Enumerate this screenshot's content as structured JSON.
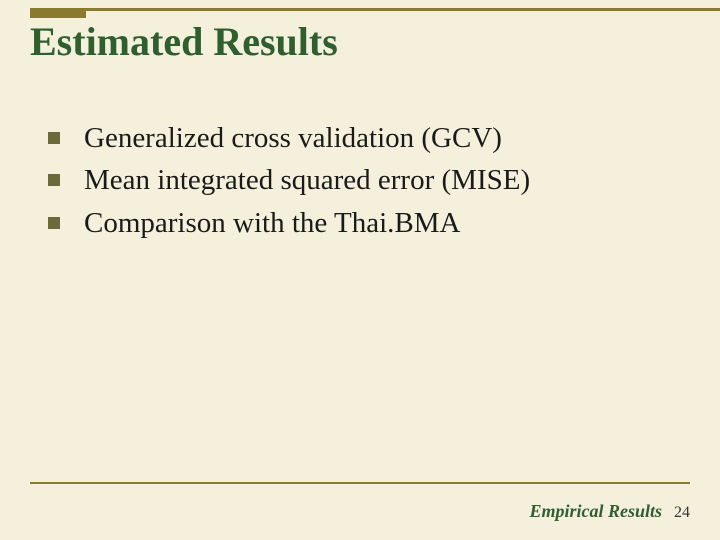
{
  "title": "Estimated Results",
  "bullets": [
    "Generalized cross validation (GCV)",
    "Mean integrated squared error (MISE)",
    "Comparison with the Thai.BMA"
  ],
  "footer": {
    "section": "Empirical Results",
    "page": "24"
  }
}
